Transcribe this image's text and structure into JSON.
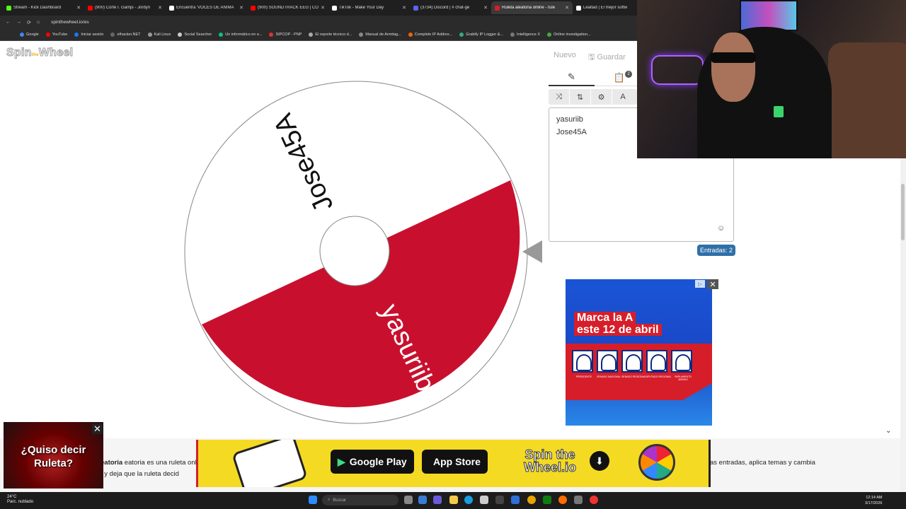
{
  "browser": {
    "tabs": [
      {
        "label": "Stream - Kick Dashboard",
        "color": "#53fc18"
      },
      {
        "label": "(900) Corte I. Gampi - Jordyn",
        "color": "#ff0000"
      },
      {
        "label": "Encuentra 'VOCES DE ANIMA",
        "color": "#ffffff"
      },
      {
        "label": "(900) SOUNDTRACK EEG | CO",
        "color": "#ff0000"
      },
      {
        "label": "TikTok - Make Your Day",
        "color": "#ffffff"
      },
      {
        "label": "(3734) Discord | # chat-ge",
        "color": "#5865f2"
      },
      {
        "label": "Ruleta aleatoria online - rule",
        "color": "#d61e2a"
      },
      {
        "label": "Lealtad | El mejor softw",
        "color": "#ffffff"
      }
    ],
    "url": "spinthewheel.io/es",
    "bookmarks": [
      "Google",
      "YouTube",
      "Iniciar sesión",
      "elhacker.NET",
      "Kali Linux",
      "Social Searcher",
      "Un informático en e...",
      "SIPCOP - PNP",
      "El reporte técnico d...",
      "Manual de Armitag...",
      "Complete IP Addres...",
      "Grabify IP Logger &...",
      "Intelligence X",
      "Online investigation..."
    ]
  },
  "logo": {
    "part1": "Spin",
    "accent": "the",
    "part2": "Wheel"
  },
  "header": {
    "new_label": "Nuevo",
    "save_label": "Guardar"
  },
  "editor": {
    "results_count": "2",
    "entries": [
      "yasuriib",
      "Jose45A"
    ],
    "count_label": "Entradas: 2",
    "toolbar_extra": "A"
  },
  "wheel": {
    "segments": [
      {
        "label": "Jose45A",
        "color": "#ffffff",
        "text_color": "#111111"
      },
      {
        "label": "yasuriib",
        "color": "#c8102e",
        "text_color": "#ffffff"
      }
    ]
  },
  "ad": {
    "line1": "Marca la A",
    "line2": "este 12 de abril",
    "candidates": [
      "PRESIDENTE",
      "SENADO NACIONAL",
      "SENADO REGIONAL",
      "DIPUTADO REGIONAL",
      "PARLAMENTO ANDINO"
    ]
  },
  "banner": {
    "google_play": "Google Play",
    "app_store": "App Store",
    "spin_logo_1": "Spin the",
    "spin_logo_2": "Wheel.io"
  },
  "description": {
    "left": "eatoria es una ruleta online y",
    "left2": ", y deja que la ruleta decid",
    "right": "as entradas, aplica temas y cambia"
  },
  "popup": {
    "text": "¿Quiso decir Ruleta?"
  },
  "taskbar": {
    "temp": "24°C",
    "weather": "Parc. nublado",
    "search_placeholder": "Buscar",
    "time": "12:14 AM",
    "date": "3/17/2026"
  }
}
